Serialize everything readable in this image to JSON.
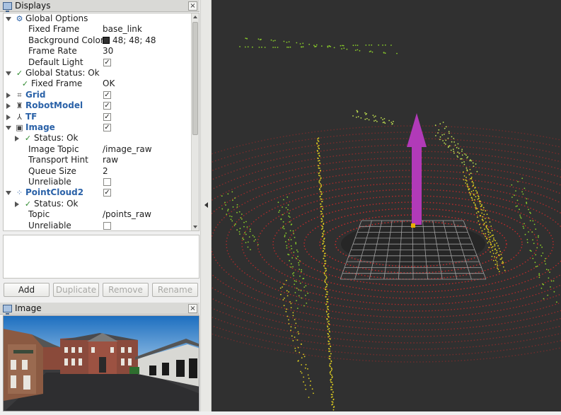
{
  "displays_panel": {
    "title": "Displays",
    "close_glyph": "×",
    "tree": [
      {
        "indent": 0,
        "expander": "down",
        "icon": "gear-icon",
        "glyph": "⚙",
        "label": "Global Options",
        "label_style": "normal",
        "value": ""
      },
      {
        "indent": 1,
        "expander": "",
        "icon": "",
        "glyph": "",
        "label": "Fixed Frame",
        "label_style": "normal",
        "value": "base_link"
      },
      {
        "indent": 1,
        "expander": "",
        "icon": "",
        "glyph": "",
        "label": "Background Color",
        "label_style": "normal",
        "value": "48; 48; 48",
        "swatch": "#303030"
      },
      {
        "indent": 1,
        "expander": "",
        "icon": "",
        "glyph": "",
        "label": "Frame Rate",
        "label_style": "normal",
        "value": "30"
      },
      {
        "indent": 1,
        "expander": "",
        "icon": "",
        "glyph": "",
        "label": "Default Light",
        "label_style": "normal",
        "checkbox": true
      },
      {
        "indent": 0,
        "expander": "down",
        "icon": "ok-check-icon",
        "glyph": "✓",
        "label": "Global Status: Ok",
        "label_style": "normal",
        "value": ""
      },
      {
        "indent": 1,
        "expander": "",
        "icon": "ok-check-icon",
        "glyph": "✓",
        "label": "Fixed Frame",
        "label_style": "normal",
        "value": "OK"
      },
      {
        "indent": 0,
        "expander": "right",
        "icon": "grid-icon",
        "glyph": "⌗",
        "label": "Grid",
        "label_style": "blue",
        "checkbox": true
      },
      {
        "indent": 0,
        "expander": "right",
        "icon": "robot-model-icon",
        "glyph": "♜",
        "label": "RobotModel",
        "label_style": "blue",
        "checkbox": true
      },
      {
        "indent": 0,
        "expander": "right",
        "icon": "tf-axes-icon",
        "glyph": "⅄",
        "label": "TF",
        "label_style": "blue",
        "checkbox": true
      },
      {
        "indent": 0,
        "expander": "down",
        "icon": "image-icon",
        "glyph": "▣",
        "label": "Image",
        "label_style": "blue",
        "checkbox": true
      },
      {
        "indent": 1,
        "expander": "right",
        "icon": "ok-check-icon",
        "glyph": "✓",
        "label": "Status: Ok",
        "label_style": "normal",
        "value": ""
      },
      {
        "indent": 1,
        "expander": "",
        "icon": "",
        "glyph": "",
        "label": "Image Topic",
        "label_style": "normal",
        "value": "/image_raw"
      },
      {
        "indent": 1,
        "expander": "",
        "icon": "",
        "glyph": "",
        "label": "Transport Hint",
        "label_style": "normal",
        "value": "raw"
      },
      {
        "indent": 1,
        "expander": "",
        "icon": "",
        "glyph": "",
        "label": "Queue Size",
        "label_style": "normal",
        "value": "2"
      },
      {
        "indent": 1,
        "expander": "",
        "icon": "",
        "glyph": "",
        "label": "Unreliable",
        "label_style": "normal",
        "checkbox": false
      },
      {
        "indent": 0,
        "expander": "down",
        "icon": "pointcloud-icon",
        "glyph": "⁘",
        "label": "PointCloud2",
        "label_style": "blue",
        "checkbox": true
      },
      {
        "indent": 1,
        "expander": "right",
        "icon": "ok-check-icon",
        "glyph": "✓",
        "label": "Status: Ok",
        "label_style": "normal",
        "value": ""
      },
      {
        "indent": 1,
        "expander": "",
        "icon": "",
        "glyph": "",
        "label": "Topic",
        "label_style": "normal",
        "value": "/points_raw"
      },
      {
        "indent": 1,
        "expander": "",
        "icon": "",
        "glyph": "",
        "label": "Unreliable",
        "label_style": "normal",
        "checkbox": false
      }
    ],
    "buttons": {
      "add": "Add",
      "duplicate": "Duplicate",
      "remove": "Remove",
      "rename": "Rename"
    }
  },
  "image_panel": {
    "title": "Image",
    "close_glyph": "×"
  },
  "view3d": {
    "background_color": "#303030",
    "grid_color": "#a0a0a0",
    "arrow_color": "#b13ab8",
    "ring_color": "#d22a2a",
    "wall_colors": [
      "#e0d020",
      "#8acd2a",
      "#c0e050"
    ]
  }
}
